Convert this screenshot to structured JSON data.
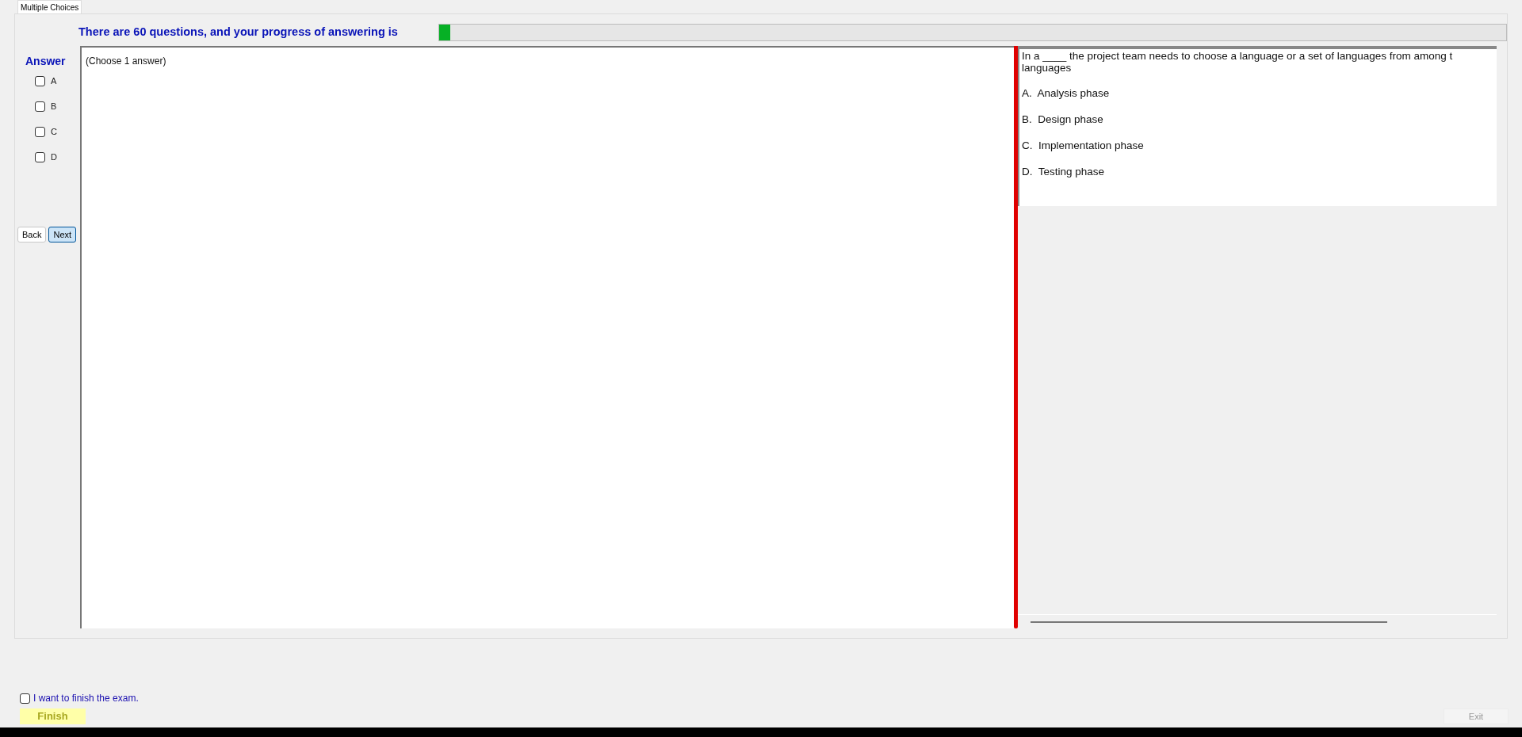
{
  "tab": {
    "label": "Multiple Choices",
    "selected": true
  },
  "progress": {
    "text": "There are 60 questions, and your progress of answering is",
    "level": 0.01
  },
  "answer": {
    "title": "Answer",
    "options": [
      {
        "label": "A",
        "checked": false
      },
      {
        "label": "B",
        "checked": false
      },
      {
        "label": "C",
        "checked": false
      },
      {
        "label": "D",
        "checked": false
      }
    ]
  },
  "nav_buttons": [
    {
      "label": "Back",
      "selected": false
    },
    {
      "label": "Next",
      "selected": true
    }
  ],
  "answer_area": {
    "text": "(Choose 1 answer)"
  },
  "question": {
    "lines": [
      "In a ____  the project team needs to choose a language or a set of languages from among t",
      "languages"
    ],
    "choices": [
      "A.  Analysis phase",
      "B.  Design phase",
      "C.  Implementation phase",
      "D.  Testing phase"
    ]
  },
  "finish": {
    "checkbox_label": "I want to finish the exam.",
    "checked": false,
    "button": "Finish"
  },
  "exit": {
    "label": "Exit",
    "disabled": true
  }
}
